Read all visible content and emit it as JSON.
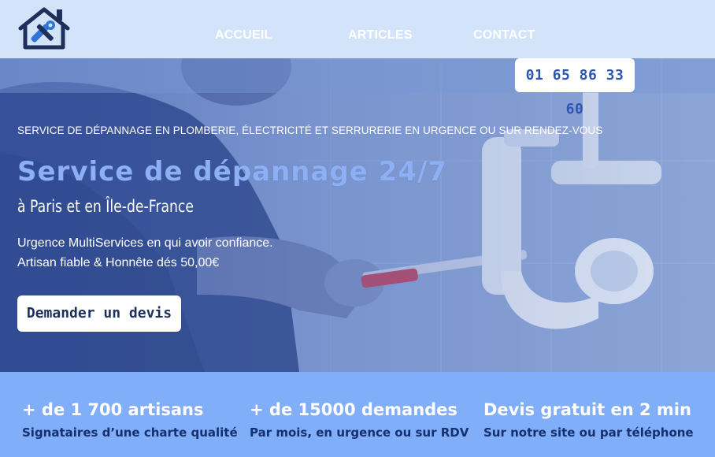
{
  "header": {
    "logo_icon": "house-wrench-icon",
    "nav": [
      "ACCUEIL",
      "ARTICLES",
      "CONTACT"
    ]
  },
  "phone": "01 65 86 33 60",
  "hero": {
    "eyebrow": "SERVICE DE DÉPANNAGE EN PLOMBERIE, ÉLECTRICITÉ ET SERRURERIE EN URGENCE OU SUR RENDEZ-VOUS",
    "headline": "Service de dépannage 24/7",
    "subhead": "à Paris et en Île-de-France",
    "desc_line1": "Urgence MultiServices en qui avoir confiance.",
    "desc_line2": "Artisan fiable & Honnête dés 50,00€",
    "cta": "Demander un devis"
  },
  "stats": [
    {
      "big": "+ de 1 700 artisans",
      "small": "Signataires d’une charte qualité"
    },
    {
      "big": "+ de 15000 demandes",
      "small": "Par mois, en urgence ou sur RDV"
    },
    {
      "big": "Devis gratuit en 2 min",
      "small": "Sur notre site ou par téléphone"
    }
  ],
  "colors": {
    "header_bg": "#d3e3fa",
    "accent_blue": "#2d56b3",
    "headline": "#8cb0f3",
    "stats_bg": "#80aef9",
    "stats_small": "#15306e"
  }
}
